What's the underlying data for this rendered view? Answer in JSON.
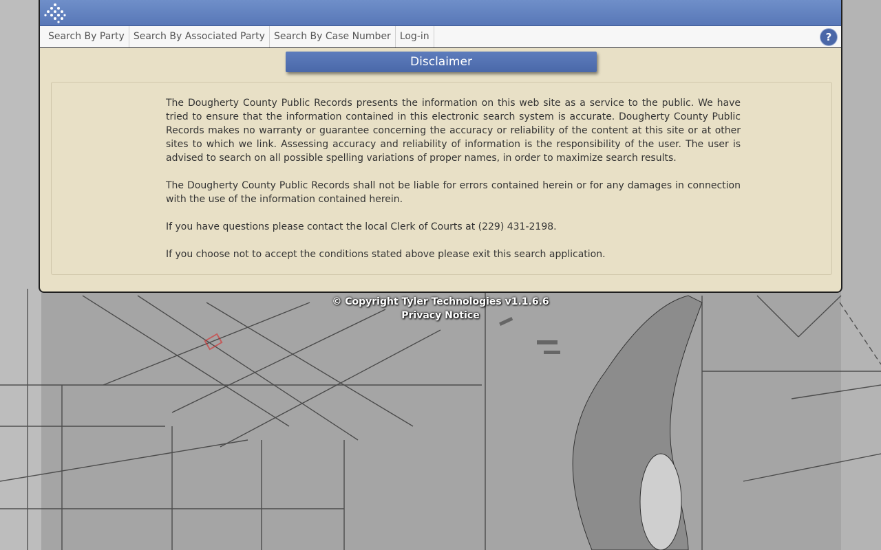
{
  "nav": {
    "items": [
      {
        "label": "Search By Party"
      },
      {
        "label": "Search By Associated Party"
      },
      {
        "label": "Search By Case Number"
      },
      {
        "label": "Log-in"
      }
    ],
    "help_label": "?"
  },
  "disclaimer": {
    "title": "Disclaimer",
    "paragraphs": [
      "The Dougherty County Public Records presents the information on this web site as a service to the public. We have tried to ensure that the information contained in this electronic search system is accurate. Dougherty County Public Records makes no warranty or guarantee concerning the accuracy or reliability of the content at this site or at other sites to which we link. Assessing accuracy and reliability of information is the responsibility of the user. The user is advised to search on all possible spelling variations of proper names, in order to maximize search results.",
      "The Dougherty County Public Records shall not be liable for errors contained herein or for any damages in connection with the use of the information contained herein.",
      "If you have questions please contact the local Clerk of Courts at (229) 431-2198.",
      "If you choose not to accept the conditions stated above please exit this search application."
    ]
  },
  "footer": {
    "copyright": "© Copyright Tyler Technologies v1.1.6.6",
    "privacy": "Privacy Notice"
  },
  "colors": {
    "accent": "#5877b7",
    "panel": "#e8e0c6"
  },
  "icons": {
    "logo": "tyler-logo-icon",
    "help": "help-icon"
  }
}
